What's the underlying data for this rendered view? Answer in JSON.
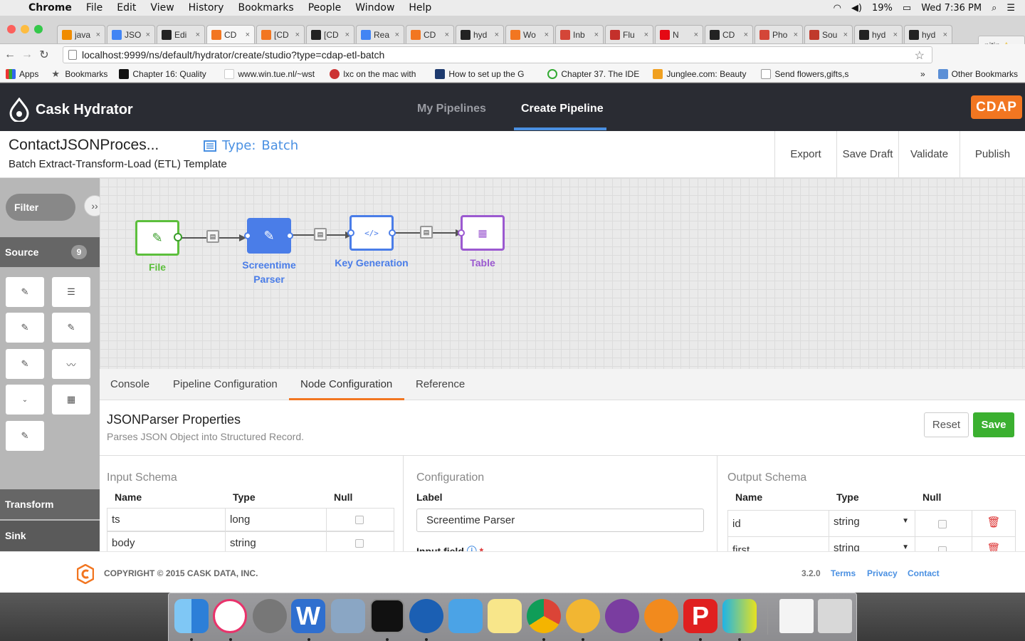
{
  "menubar": {
    "app": "Chrome",
    "items": [
      "File",
      "Edit",
      "View",
      "History",
      "Bookmarks",
      "People",
      "Window",
      "Help"
    ],
    "battery": "19%",
    "clock": "Wed 7:36 PM"
  },
  "browser": {
    "tabs": [
      "java",
      "JSO",
      "Edi",
      "CD",
      "[CD",
      "[CD",
      "Rea",
      "CD",
      "hyd",
      "Wo",
      "Inb",
      "Flu",
      "N",
      "CD",
      "Pho",
      "Sou",
      "hyd",
      "hyd"
    ],
    "profile": "nitin",
    "url": "localhost:9999/ns/default/hydrator/create/studio?type=cdap-etl-batch"
  },
  "bookmarks": [
    "Apps",
    "Bookmarks",
    "Chapter 16: Quality",
    "www.win.tue.nl/~wst",
    "lxc on the mac with",
    "How to set up the G",
    "Chapter 37. The IDE",
    "Junglee.com: Beauty",
    "Send flowers,gifts,s",
    "Other Bookmarks"
  ],
  "app": {
    "brand": "Cask Hydrator",
    "nav": [
      "My Pipelines",
      "Create Pipeline"
    ],
    "cdap_logo": "CDAP",
    "colors": {
      "header": "#2a2c33",
      "accent": "#4a90e2",
      "orange": "#f27621",
      "green": "#3bb030"
    }
  },
  "pipeline": {
    "name": "ContactJSONProces...",
    "type_label": "Type:",
    "type_value": "Batch",
    "template": "Batch Extract-Transform-Load (ETL) Template",
    "actions": [
      "Export",
      "Save Draft",
      "Validate",
      "Publish"
    ]
  },
  "palette": {
    "filter": "Filter",
    "source_label": "Source",
    "source_count": "9",
    "transform_label": "Transform",
    "sink_label": "Sink"
  },
  "nodes": [
    {
      "label": "File"
    },
    {
      "label_1": "Screentime",
      "label_2": "Parser"
    },
    {
      "label": "Key Generation"
    },
    {
      "label": "Table"
    }
  ],
  "bottom_tabs": [
    "Console",
    "Pipeline Configuration",
    "Node Configuration",
    "Reference"
  ],
  "properties": {
    "title": "JSONParser Properties",
    "description": "Parses JSON Object into Structured Record.",
    "reset": "Reset",
    "save": "Save",
    "input_schema": {
      "title": "Input Schema",
      "headers": [
        "Name",
        "Type",
        "Null"
      ],
      "rows": [
        {
          "name": "ts",
          "type": "long"
        },
        {
          "name": "body",
          "type": "string"
        }
      ]
    },
    "configuration": {
      "title": "Configuration",
      "label_title": "Label",
      "label_value": "Screentime Parser",
      "input_field": "Input field"
    },
    "output_schema": {
      "title": "Output Schema",
      "headers": [
        "Name",
        "Type",
        "Null"
      ],
      "rows": [
        {
          "name": "id",
          "type": "string"
        },
        {
          "name": "first",
          "type": "string"
        }
      ]
    }
  },
  "footer": {
    "copyright": "COPYRIGHT © 2015 CASK DATA, INC.",
    "version": "3.2.0",
    "links": [
      "Terms",
      "Privacy",
      "Contact"
    ]
  }
}
